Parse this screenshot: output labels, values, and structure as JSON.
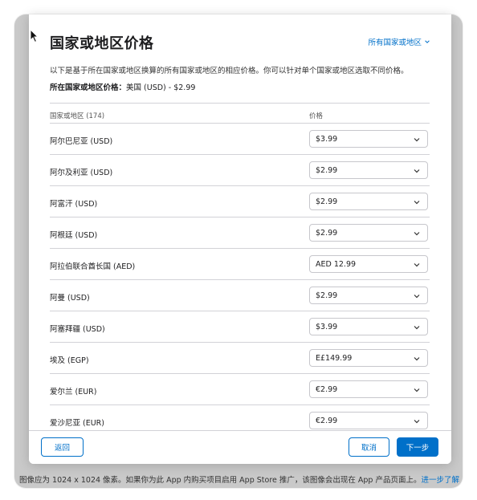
{
  "dialog": {
    "title": "国家或地区价格",
    "filter_label": "所有国家或地区",
    "description": "以下是基于所在国家或地区换算的所有国家或地区的相应价格。你可以针对单个国家或地区选取不同价格。",
    "base_label": "所在国家或地区价格：",
    "base_value": "美国 (USD) - $2.99"
  },
  "table": {
    "col_region": "国家或地区 (174)",
    "col_price": "价格",
    "rows": [
      {
        "region": "阿尔巴尼亚 (USD)",
        "price": "$3.99"
      },
      {
        "region": "阿尔及利亚 (USD)",
        "price": "$2.99"
      },
      {
        "region": "阿富汗 (USD)",
        "price": "$2.99"
      },
      {
        "region": "阿根廷 (USD)",
        "price": "$2.99"
      },
      {
        "region": "阿拉伯联合酋长国 (AED)",
        "price": "AED 12.99"
      },
      {
        "region": "阿曼 (USD)",
        "price": "$2.99"
      },
      {
        "region": "阿塞拜疆 (USD)",
        "price": "$3.99"
      },
      {
        "region": "埃及 (EGP)",
        "price": "E£149.99"
      },
      {
        "region": "爱尔兰 (EUR)",
        "price": "€2.99"
      },
      {
        "region": "爱沙尼亚 (EUR)",
        "price": "€2.99"
      }
    ]
  },
  "footer": {
    "back_label": "返回",
    "cancel_label": "取消",
    "next_label": "下一步"
  },
  "background": {
    "note_text": "图像应为 1024 x 1024 像素。如果你为此 App 内购买项目启用 App Store 推广，该图像会出现在 App 产品页面上。",
    "note_link": "进一步了解"
  },
  "icons": {
    "filter": "chevron-down-icon",
    "select": "chevron-down-icon",
    "cursor": "mouse-pointer-icon"
  },
  "colors": {
    "accent": "#0070c9",
    "divider": "#d2d2d7",
    "backdrop": "#c9c9c9"
  }
}
